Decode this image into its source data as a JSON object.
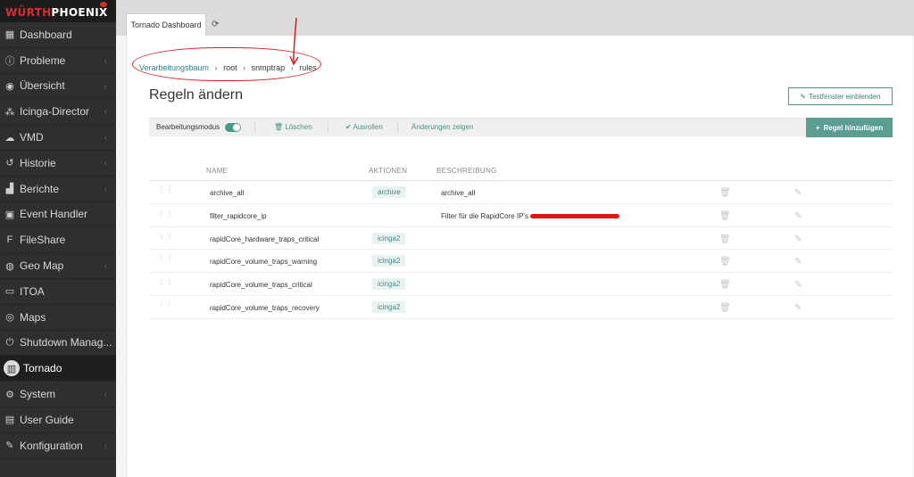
{
  "brand": {
    "logo_red": "WÜRTH",
    "logo_white": "PHOENIX"
  },
  "sidebar": {
    "items": [
      {
        "label": "Dashboard",
        "icon": "dashboard-icon",
        "chevron": false,
        "active": false
      },
      {
        "label": "Probleme",
        "icon": "alert-circle-icon",
        "chevron": true,
        "active": false
      },
      {
        "label": "Übersicht",
        "icon": "eye-icon",
        "chevron": true,
        "active": false
      },
      {
        "label": "Icinga-Director",
        "icon": "nodes-icon",
        "chevron": true,
        "active": false
      },
      {
        "label": "VMD",
        "icon": "cloud-icon",
        "chevron": true,
        "active": false
      },
      {
        "label": "Historie",
        "icon": "history-icon",
        "chevron": true,
        "active": false
      },
      {
        "label": "Berichte",
        "icon": "bar-chart-icon",
        "chevron": true,
        "active": false
      },
      {
        "label": "Event Handler",
        "icon": "event-handler-icon",
        "chevron": false,
        "active": false
      },
      {
        "label": "FileShare",
        "icon": "fileshare-icon",
        "chevron": false,
        "active": false
      },
      {
        "label": "Geo Map",
        "icon": "globe-icon",
        "chevron": true,
        "active": false
      },
      {
        "label": "ITOA",
        "icon": "itoa-icon",
        "chevron": false,
        "active": false
      },
      {
        "label": "Maps",
        "icon": "map-icon",
        "chevron": false,
        "active": false
      },
      {
        "label": "Shutdown Manag...",
        "icon": "power-icon",
        "chevron": false,
        "active": false
      },
      {
        "label": "Tornado",
        "icon": "tornado-icon",
        "chevron": false,
        "active": true
      },
      {
        "label": "System",
        "icon": "gear-icon",
        "chevron": true,
        "active": false
      },
      {
        "label": "User Guide",
        "icon": "book-icon",
        "chevron": false,
        "active": false
      },
      {
        "label": "Konfiguration",
        "icon": "wrench-icon",
        "chevron": true,
        "active": false
      }
    ]
  },
  "tabs": {
    "active_label": "Tornado Dashboard"
  },
  "breadcrumb": {
    "root_link": "Verarbeitungsbaum",
    "items": [
      "root",
      "snmptrap",
      "rules"
    ],
    "separator": "›"
  },
  "page": {
    "title": "Regeln ändern",
    "test_window_button": "Testfenster einblenden"
  },
  "toolbar": {
    "edit_mode_label": "Bearbeitungsmodus",
    "edit_mode_on": true,
    "delete_label": "Löschen",
    "rollout_label": "Ausrollen",
    "show_changes_label": "Änderungen zeigen",
    "add_rule_label": "Regel hinzufügen"
  },
  "table": {
    "headers": {
      "name": "NAME",
      "actions": "AKTIONEN",
      "description": "BESCHREIBUNG"
    },
    "rows": [
      {
        "name": "archive_all",
        "action": "archive",
        "description": "archive_all"
      },
      {
        "name": "filter_rapidcore_ip",
        "action": "",
        "description": "Filter für die RapidCore IP's"
      },
      {
        "name": "rapidCore_hardware_traps_critical",
        "action": "icinga2",
        "description": ""
      },
      {
        "name": "rapidCore_volume_traps_warning",
        "action": "icinga2",
        "description": ""
      },
      {
        "name": "rapidCore_volume_traps_critical",
        "action": "icinga2",
        "description": ""
      },
      {
        "name": "rapidCore_volume_traps_recovery",
        "action": "icinga2",
        "description": ""
      }
    ]
  },
  "colors": {
    "accent": "#5a9e92",
    "annotation": "#d42020",
    "sidebar_bg": "#2f2f2f"
  }
}
